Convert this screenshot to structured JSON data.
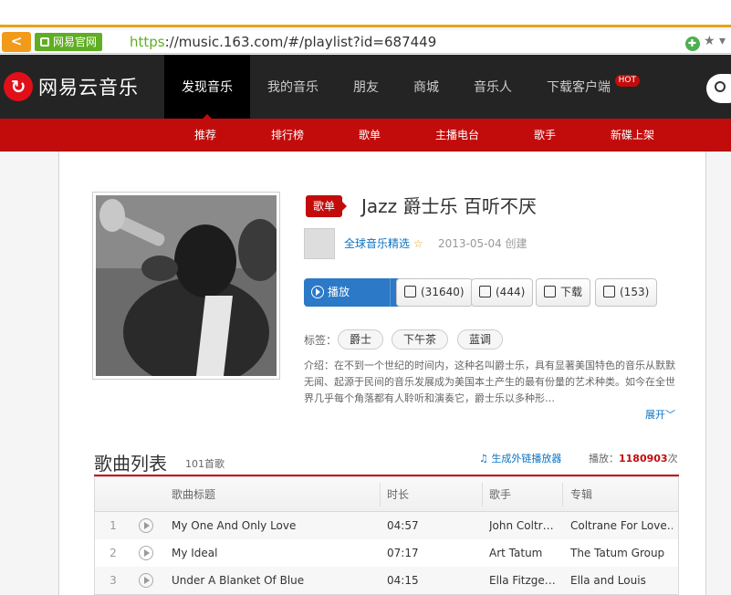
{
  "browser": {
    "back_glyph": "<",
    "site_label": "网易官网",
    "url_scheme": "https",
    "url_rest": "://music.163.com/#/playlist?id=687449"
  },
  "nav": {
    "logo_text": "网易云音乐",
    "items": [
      "发现音乐",
      "我的音乐",
      "朋友",
      "商城",
      "音乐人",
      "下载客户端"
    ],
    "hot": "HOT"
  },
  "subnav": [
    "推荐",
    "排行榜",
    "歌单",
    "主播电台",
    "歌手",
    "新碟上架"
  ],
  "playlist": {
    "badge": "歌单",
    "title": "Jazz 爵士乐 百听不厌",
    "creator": "全球音乐精选",
    "created": "2013-05-04 创建",
    "play_label": "播放",
    "plus": "+",
    "collect": "(31640)",
    "share": "(444)",
    "download": "下载",
    "comments": "(153)",
    "tags_label": "标签：",
    "tags": [
      "爵士",
      "下午茶",
      "蓝调"
    ],
    "intro": "介绍：在不到一个世纪的时间内，这种名叫爵士乐，具有显著美国特色的音乐从默默无闻、起源于民间的音乐发展成为美国本土产生的最有份量的艺术种类。如今在全世界几乎每个角落都有人聆听和演奏它，爵士乐以多种形…",
    "expand": "展开"
  },
  "songlist": {
    "title": "歌曲列表",
    "count": "101首歌",
    "gen_link": "生成外链播放器",
    "plays_label": "播放：",
    "plays_value": "1180903",
    "plays_unit": "次",
    "headers": [
      "歌曲标题",
      "时长",
      "歌手",
      "专辑"
    ],
    "rows": [
      {
        "no": "1",
        "title": "My One And Only Love",
        "duration": "04:57",
        "artist": "John Coltr…",
        "album": "Coltrane For Love…"
      },
      {
        "no": "2",
        "title": "My Ideal",
        "duration": "07:17",
        "artist": "Art Tatum",
        "album": "The Tatum Group"
      },
      {
        "no": "3",
        "title": "Under A Blanket Of Blue",
        "duration": "04:15",
        "artist": "Ella Fitzge…",
        "album": "Ella and Louis"
      }
    ]
  },
  "colors": {
    "brand_red": "#c20c0c",
    "nav_dark": "#242424",
    "link_blue": "#0c73c2",
    "play_blue": "#2b79c7"
  }
}
